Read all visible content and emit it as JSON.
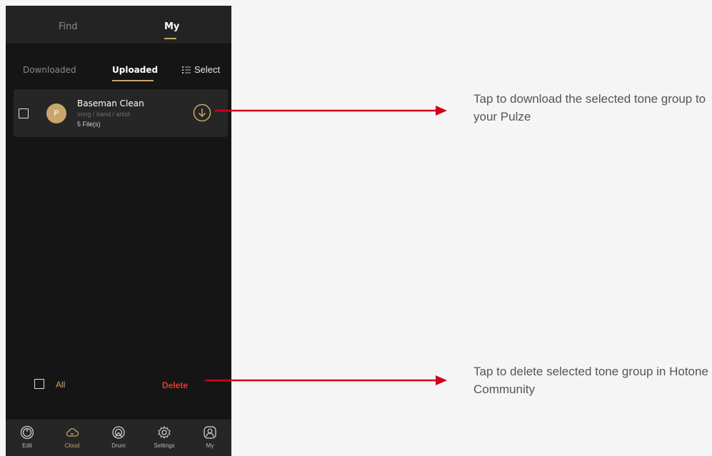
{
  "top_tabs": {
    "find": "Find",
    "my": "My"
  },
  "sub_tabs": {
    "downloaded": "Downloaded",
    "uploaded": "Uploaded",
    "select": "Select"
  },
  "item": {
    "avatar_letter": "P",
    "name": "Baseman Clean",
    "meta": "song / band / artist",
    "files": "5 File(s)"
  },
  "actions": {
    "all": "All",
    "delete": "Delete"
  },
  "nav": [
    {
      "label": "Edit",
      "icon": "knob-icon"
    },
    {
      "label": "Cloud",
      "icon": "cloud-icon"
    },
    {
      "label": "Drum",
      "icon": "drum-icon"
    },
    {
      "label": "Settings",
      "icon": "gear-icon"
    },
    {
      "label": "My",
      "icon": "user-icon"
    }
  ],
  "annotations": {
    "download": "Tap to download the selected tone group to your Pulze",
    "delete": "Tap to delete selected tone group in Hotone Community"
  },
  "colors": {
    "accent": "#c9a66b",
    "delete": "#e03a2c",
    "arrow": "#d0021b"
  }
}
